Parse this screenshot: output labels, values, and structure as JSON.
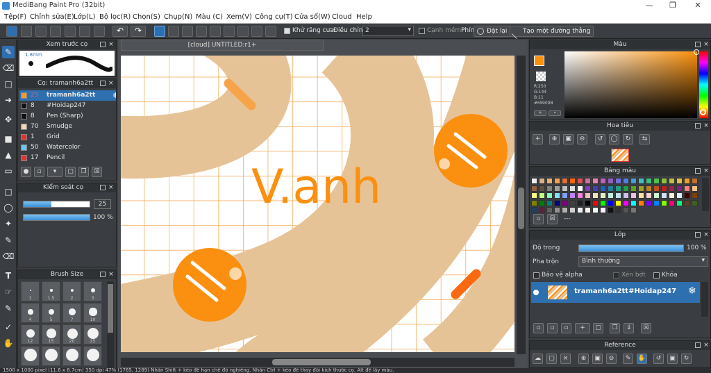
{
  "app": {
    "title": "MediBang Paint Pro (32bit)"
  },
  "menu": [
    "Tệp(F)",
    "Chỉnh sửa(E)",
    "Lớp(L)",
    "Bộ lọc(R)",
    "Chọn(S)",
    "Chụp(N)",
    "Màu (C)",
    "Xem(V)",
    "Công cụ(T)",
    "Cửa sổ(W)",
    "Cloud",
    "Help"
  ],
  "toolbar": {
    "antialias_label": "Khử răng cưa",
    "adjust_label": "Điều chỉnh",
    "adjust_value": "2",
    "snap_label": "Cạnh mềm",
    "key_label": "Phím",
    "reset_label": "Đặt lại",
    "line_label": "Tạo một đường thẳng"
  },
  "brush_preview": {
    "title": "Xem trước cọ",
    "size": "1.8mm"
  },
  "brush_list": {
    "title": "Cọ: tramanh6a2tt",
    "items": [
      {
        "num": "25",
        "name": "tramanh6a2tt",
        "color": "#f29a30",
        "selected": true
      },
      {
        "num": "8",
        "name": "#Hoidap247",
        "color": "#111111"
      },
      {
        "num": "8",
        "name": "Pen (Sharp)",
        "color": "#111111"
      },
      {
        "num": "70",
        "name": "Smudge",
        "color": "#f3d6b6"
      },
      {
        "num": "1",
        "name": "Grid",
        "color": "#e53030"
      },
      {
        "num": "50",
        "name": "Watercolor",
        "color": "#66c8f0"
      },
      {
        "num": "17",
        "name": "Pencil",
        "color": "#e53030"
      }
    ]
  },
  "brush_control": {
    "title": "Kiểm soát cọ",
    "size_value": "25",
    "size_fraction": 0.42,
    "opacity_label": "100 %",
    "opacity_fraction": 1.0
  },
  "brush_size": {
    "title": "Brush Size",
    "labels": [
      "1",
      "1.5",
      "2",
      "3",
      "4",
      "5",
      "7",
      "10",
      "12",
      "15",
      "20",
      "25"
    ]
  },
  "document": {
    "tab_title": "[cloud] UNTITLED:r1+"
  },
  "canvas_text": "V.anh",
  "color_panel": {
    "title": "Màu",
    "r": "R:250",
    "g": "G:144",
    "b": "B:11",
    "hex": "#FA900B",
    "fg": "#fa900b"
  },
  "navigator": {
    "title": "Hoa tiêu"
  },
  "palette": {
    "title": "Bảng màu",
    "more": "---",
    "colors": [
      "#eeeeee",
      "#d9b08c",
      "#e8b070",
      "#f4a050",
      "#e0703a",
      "#ff6600",
      "#e05050",
      "#d070a0",
      "#f080b0",
      "#c060c0",
      "#9060c0",
      "#7070e0",
      "#5080e0",
      "#40a0e0",
      "#40c0c0",
      "#40c080",
      "#50c050",
      "#90c040",
      "#c0c040",
      "#e0c040",
      "#f0a020",
      "#c07030",
      "#906040",
      "#605040",
      "#808080",
      "#a0a0a0",
      "#c0c0c0",
      "#e0e0e0",
      "#ffffff",
      "#8040c0",
      "#4040c0",
      "#2060c0",
      "#2080a0",
      "#20a080",
      "#20a040",
      "#60a020",
      "#a0a020",
      "#c08020",
      "#c05020",
      "#c02020",
      "#a02050",
      "#802080",
      "#ff8080",
      "#ffc080",
      "#ffff80",
      "#c0ff80",
      "#80ffc0",
      "#80e0ff",
      "#80a0ff",
      "#c080ff",
      "#ff80e0",
      "#f0c0c0",
      "#f0e0c0",
      "#e0f0c0",
      "#c0f0e0",
      "#c0e0f0",
      "#d0c0f0",
      "#f0c0e0",
      "#ffe0a0",
      "#ffd0d0",
      "#d0ffd0",
      "#d0e0ff",
      "#ffeedd",
      "#ddeeff",
      "#400000",
      "#804000",
      "#808000",
      "#008000",
      "#008080",
      "#000080",
      "#800080",
      "#404040",
      "#202020",
      "#000000",
      "#ff0000",
      "#00ff00",
      "#0000ff",
      "#ffff00",
      "#ff00ff",
      "#00ffff",
      "#ff8000",
      "#8000ff",
      "#0080ff",
      "#80ff00",
      "#ff0080",
      "#00ff80",
      "#604020",
      "#406020",
      "#204060",
      "#602040",
      "#606060",
      "#909090",
      "#b0b0b0",
      "#d0d0d0",
      "#f0f0f0",
      "#fff8f0",
      "#f0fff8",
      "#f8f0ff",
      "#111111",
      "#333333",
      "#555555",
      "#777777"
    ]
  },
  "layer_panel": {
    "title": "Lớp",
    "opacity_label": "Độ trong",
    "opacity_value": "100 %",
    "opacity_fraction": 1.0,
    "blend_label": "Pha trộn",
    "blend_value": "Bình thường",
    "protect_alpha": "Bảo vệ alpha",
    "clipping": "Xén bớt",
    "lock": "Khóa",
    "layer_name": "tramanh6a2tt#Hoidap247"
  },
  "reference": {
    "title": "Reference"
  },
  "status": {
    "text": "1500 x 1000 pixel (11.6 x 8.7cm)  350 dpi  47%  (1765, 1289)  Nhấn Shift + kéo để hạn chế độ nghiêng. Nhấn Ctrl + kéo để thay đổi kích thước cọ. Alt để lấy màu."
  }
}
